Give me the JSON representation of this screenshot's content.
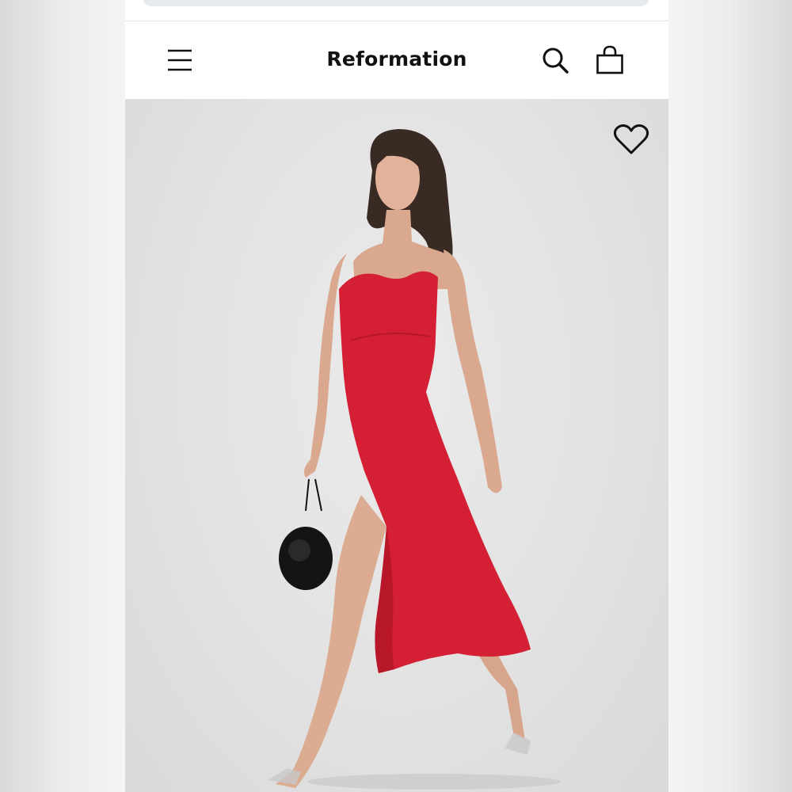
{
  "header": {
    "brand": "Reformation",
    "menu_icon": "hamburger-menu-icon",
    "search_icon": "search-icon",
    "bag_icon": "shopping-bag-icon"
  },
  "product": {
    "image": "product-photo-red-midi-dress",
    "wishlist_icon": "heart-outline-icon"
  },
  "colors": {
    "dress": "#d41f35",
    "background": "#e4e4e4",
    "text": "#111111"
  }
}
